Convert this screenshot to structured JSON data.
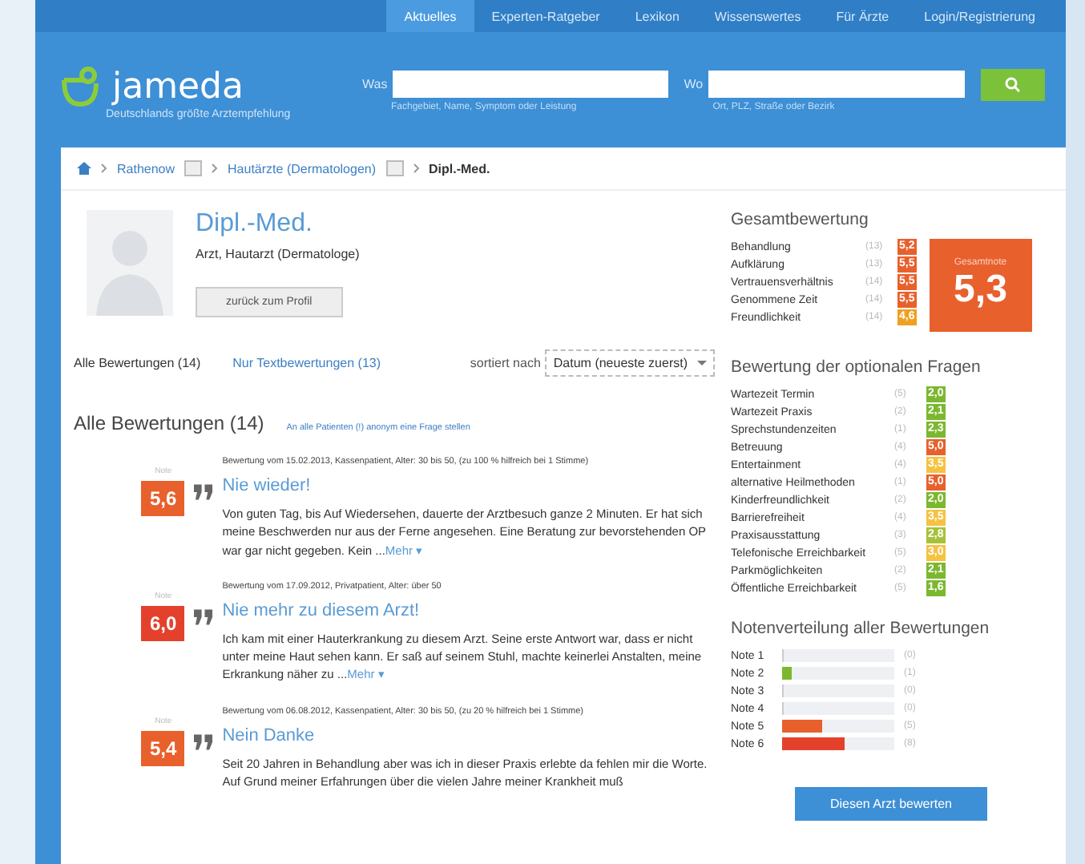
{
  "top_nav": [
    {
      "label": "Aktuelles",
      "selected": true
    },
    {
      "label": "Experten-Ratgeber",
      "selected": false
    },
    {
      "label": "Lexikon",
      "selected": false
    },
    {
      "label": "Wissenswertes",
      "selected": false
    },
    {
      "label": "Für Ärzte",
      "selected": false
    },
    {
      "label": "Login/Registrierung",
      "selected": false
    }
  ],
  "logo": {
    "name": "jameda",
    "tagline": "Deutschlands größte Arztempfehlung"
  },
  "search": {
    "what_label": "Was",
    "what_hint": "Fachgebiet, Name, Symptom oder Leistung",
    "where_label": "Wo",
    "where_hint": "Ort, PLZ, Straße oder Bezirk"
  },
  "breadcrumb": [
    {
      "label": "Rathenow",
      "dropdown": true
    },
    {
      "label": "Hautärzte (Dermatologen)",
      "dropdown": true
    },
    {
      "label": "Dipl.-Med.",
      "dropdown": false
    }
  ],
  "doctor": {
    "name": "Dipl.-Med.",
    "specialty": "Arzt, Hautarzt (Dermatologe)",
    "back_button": "zurück zum Profil"
  },
  "filter_tabs": [
    {
      "label": "Alle Bewertungen (14)",
      "selected": true
    },
    {
      "label": "Nur Textbewertungen (13)",
      "selected": false
    }
  ],
  "sort": {
    "label": "sortiert nach",
    "value": "Datum (neueste zuerst)"
  },
  "reviews_heading": "Alle Bewertungen (14)",
  "ask_link": "An alle Patienten (!) anonym eine Frage stellen",
  "reviews": [
    {
      "grade_label": "Note",
      "grade": "5,6",
      "color": "#e8602c",
      "meta": "Bewertung vom 15.02.2013, Kassenpatient, Alter: 30 bis 50, (zu 100 % hilfreich bei 1 Stimme)",
      "title": "Nie wieder!",
      "body": "Von guten Tag, bis Auf Wiedersehen, dauerte der Arztbesuch ganze 2 Minuten. Er hat sich meine Beschwerden nur aus der Ferne angesehen. Eine Beratung zur bevorstehenden OP war gar nicht gegeben. Kein ...",
      "more": "Mehr ▾"
    },
    {
      "grade_label": "Note",
      "grade": "6,0",
      "color": "#e4412c",
      "meta": "Bewertung vom 17.09.2012, Privatpatient, Alter: über 50",
      "title": "Nie mehr zu diesem Arzt!",
      "body": "Ich kam mit einer Hauterkrankung zu diesem Arzt. Seine erste Antwort war, dass er nicht unter meine Haut sehen kann. Er saß auf seinem Stuhl, machte keinerlei Anstalten, meine Erkrankung näher zu ...",
      "more": "Mehr ▾"
    },
    {
      "grade_label": "Note",
      "grade": "5,4",
      "color": "#e8602c",
      "meta": "Bewertung vom 06.08.2012, Kassenpatient, Alter: 30 bis 50, (zu 20 % hilfreich bei 1 Stimme)",
      "title": "Nein Danke",
      "body": "Seit 20 Jahren in Behandlung aber was ich in dieser Praxis erlebte da fehlen mir die Worte. Auf Grund meiner Erfahrungen über die vielen Jahre meiner Krankheit muß"
    }
  ],
  "overall": {
    "title": "Gesamtbewertung",
    "total_label": "Gesamtnote",
    "total": "5,3",
    "items": [
      {
        "label": "Behandlung",
        "count": "(13)",
        "grade": "5,2",
        "color": "#e8602c"
      },
      {
        "label": "Aufklärung",
        "count": "(13)",
        "grade": "5,5",
        "color": "#e8602c"
      },
      {
        "label": "Vertrauensverhältnis",
        "count": "(14)",
        "grade": "5,5",
        "color": "#e8602c"
      },
      {
        "label": "Genommene Zeit",
        "count": "(14)",
        "grade": "5,5",
        "color": "#e8602c"
      },
      {
        "label": "Freundlichkeit",
        "count": "(14)",
        "grade": "4,6",
        "color": "#f0a020"
      }
    ]
  },
  "optional": {
    "title": "Bewertung der optionalen Fragen",
    "items": [
      {
        "label": "Wartezeit Termin",
        "count": "(5)",
        "grade": "2,0",
        "color": "#7cb82f"
      },
      {
        "label": "Wartezeit Praxis",
        "count": "(2)",
        "grade": "2,1",
        "color": "#7cb82f"
      },
      {
        "label": "Sprechstundenzeiten",
        "count": "(1)",
        "grade": "2,3",
        "color": "#7cb82f"
      },
      {
        "label": "Betreuung",
        "count": "(4)",
        "grade": "5,0",
        "color": "#e8602c"
      },
      {
        "label": "Entertainment",
        "count": "(4)",
        "grade": "3,5",
        "color": "#f5c242"
      },
      {
        "label": "alternative Heilmethoden",
        "count": "(1)",
        "grade": "5,0",
        "color": "#e8602c"
      },
      {
        "label": "Kinderfreundlichkeit",
        "count": "(2)",
        "grade": "2,0",
        "color": "#7cb82f"
      },
      {
        "label": "Barrierefreiheit",
        "count": "(4)",
        "grade": "3,5",
        "color": "#f5c242"
      },
      {
        "label": "Praxisausstattung",
        "count": "(3)",
        "grade": "2,8",
        "color": "#a6c23a"
      },
      {
        "label": "Telefonische Erreichbarkeit",
        "count": "(5)",
        "grade": "3,0",
        "color": "#f5c242"
      },
      {
        "label": "Parkmöglichkeiten",
        "count": "(2)",
        "grade": "2,1",
        "color": "#7cb82f"
      },
      {
        "label": "Öffentliche Erreichbarkeit",
        "count": "(5)",
        "grade": "1,6",
        "color": "#7cb82f"
      }
    ]
  },
  "distribution": {
    "title": "Notenverteilung aller Bewertungen",
    "items": [
      {
        "label": "Note 1",
        "count": "(0)",
        "level": 0
      },
      {
        "label": "Note 2",
        "count": "(1)",
        "level": 0.08,
        "color": "#7cb82f"
      },
      {
        "label": "Note 3",
        "count": "(0)",
        "level": 0
      },
      {
        "label": "Note 4",
        "count": "(0)",
        "level": 0
      },
      {
        "label": "Note 5",
        "count": "(5)",
        "level": 0.35,
        "color": "#e8602c"
      },
      {
        "label": "Note 6",
        "count": "(8)",
        "level": 0.56,
        "color": "#e4412c"
      }
    ]
  },
  "rate_button": "Diesen Arzt bewerten"
}
